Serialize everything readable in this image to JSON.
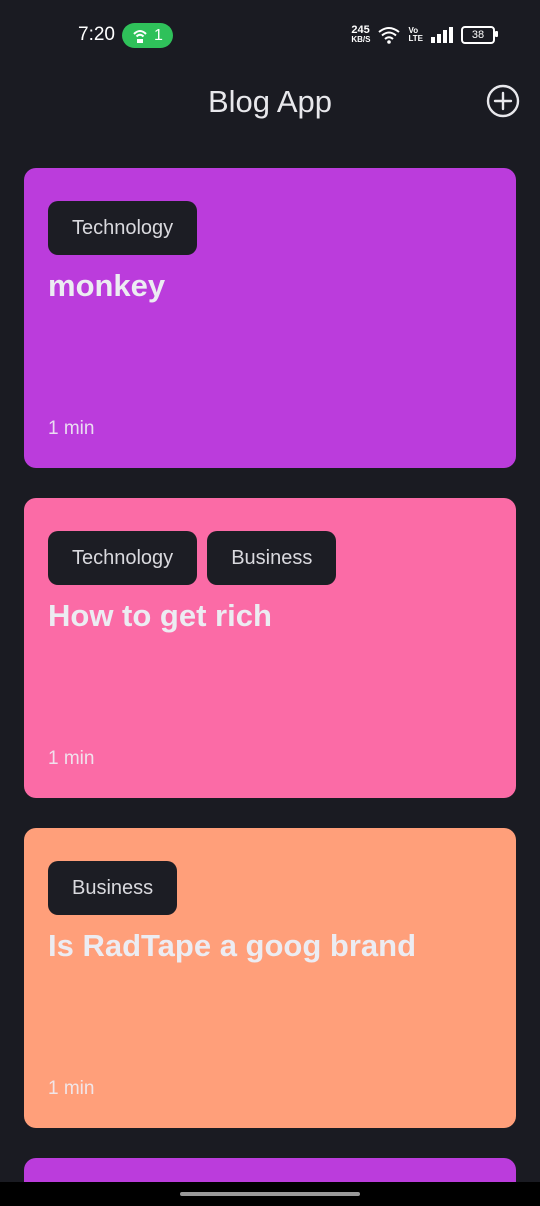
{
  "status_bar": {
    "time": "7:20",
    "hotspot_count": "1",
    "net_speed_value": "245",
    "net_speed_unit": "KB/S",
    "volte_top": "Vo",
    "volte_bottom": "LTE",
    "battery": "38",
    "icons": [
      "hotspot-icon",
      "wifi-icon",
      "signal-icon",
      "battery-icon"
    ]
  },
  "app_bar": {
    "title": "Blog App",
    "add_icon": "add-circle-icon"
  },
  "colors": {
    "background": "#1a1b22",
    "card_purple": "#bb3cdc",
    "card_pink": "#fb6ba6",
    "card_peach": "#ff9f7a",
    "tag_bg": "#1c1d24"
  },
  "posts": [
    {
      "tags": [
        "Technology"
      ],
      "title": "monkey",
      "read_time": "1 min",
      "color": "#bb3cdc"
    },
    {
      "tags": [
        "Technology",
        "Business"
      ],
      "title": "How to get rich",
      "read_time": "1 min",
      "color": "#fb6ba6"
    },
    {
      "tags": [
        "Business"
      ],
      "title": "Is RadTape a goog brand",
      "read_time": "1 min",
      "color": "#ff9f7a"
    },
    {
      "tags": [],
      "title": "",
      "read_time": "",
      "color": "#bb3cdc"
    }
  ]
}
